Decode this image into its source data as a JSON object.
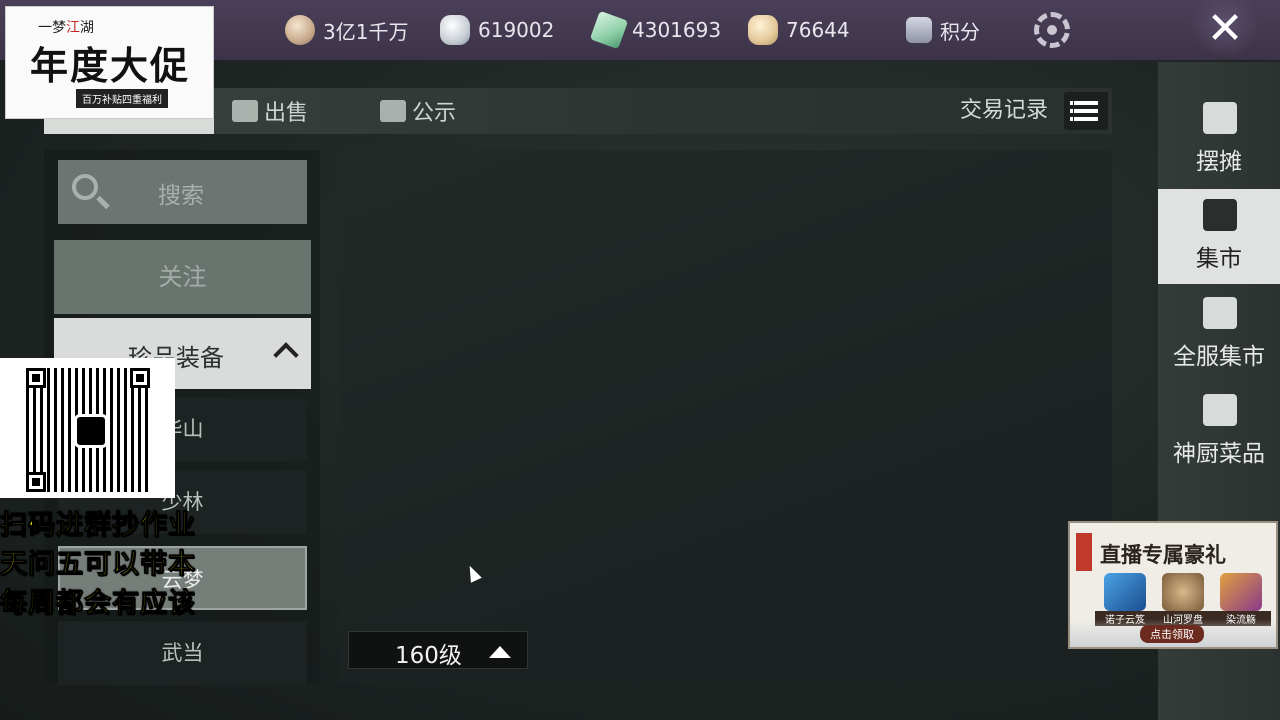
{
  "header": {
    "currencies": [
      {
        "icon": "coin-icon",
        "value": "3亿1千万"
      },
      {
        "icon": "silver-ingot-icon",
        "value": "619002"
      },
      {
        "icon": "jade-icon",
        "value": "4301693"
      },
      {
        "icon": "gold-ingot-icon",
        "value": "76644"
      }
    ],
    "points_label": "积分",
    "close_label": "✕"
  },
  "logo": {
    "line1a": "一梦",
    "line1b": "江",
    "line1c": "湖",
    "title": "年度大促",
    "subtitle": "百万补贴四重福利"
  },
  "tabs": [
    {
      "label": "出售"
    },
    {
      "label": "公示"
    }
  ],
  "trade_records_label": "交易记录",
  "left_menu": {
    "search_label": "搜索",
    "follow_label": "关注",
    "category_label": "珍品装备",
    "subcategories": [
      "华山",
      "少林",
      "云梦",
      "武当"
    ]
  },
  "level_filter": {
    "label": "160级"
  },
  "right_nav": [
    {
      "label": "摆摊",
      "icon": "stall-icon"
    },
    {
      "label": "集市",
      "icon": "scale-icon"
    },
    {
      "label": "全服集市",
      "icon": "global-scale-icon"
    },
    {
      "label": "神厨菜品",
      "icon": "kitchen-icon"
    }
  ],
  "promo": {
    "lines": [
      "扫码进群抄作业",
      "天问五可以带本",
      "每周都会有应该"
    ]
  },
  "live_ad": {
    "title": "直播专属豪礼",
    "items": [
      "诺子云笈",
      "山河罗盘",
      "染流觞"
    ],
    "claim_label": "点击领取"
  },
  "colors": {
    "topbar": "#3c3349",
    "accent_selected": "#dfe2e0",
    "promo_text": "#ffff00"
  }
}
